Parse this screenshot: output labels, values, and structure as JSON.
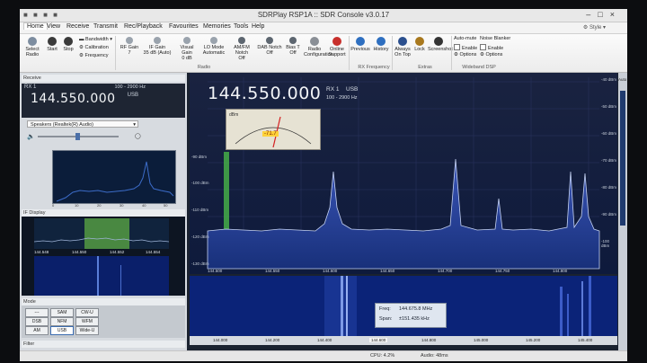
{
  "window": {
    "title": "SDRPlay RSP1A :: SDR Console v3.0.17"
  },
  "menu": [
    "Home",
    "View",
    "Receive",
    "Transmit",
    "Rec/Playback",
    "Favourites",
    "Memories",
    "Tools",
    "Help"
  ],
  "style_label": "Style",
  "ribbon": {
    "select_radio": "Select Radio",
    "start": "Start",
    "stop": "Stop",
    "bandwidth": "Bandwidth",
    "calibration": "Calibration",
    "frequency": "Frequency",
    "rf_gain_label": "RF Gain",
    "rf_gain_value": "7",
    "if_gain_label": "IF Gain",
    "if_gain_value": "35 dB (Auto)",
    "visual_gain_label": "Visual Gain",
    "visual_gain_value": "0 dB",
    "lo_mode_label": "LO Mode",
    "lo_mode_value": "Automatic",
    "am_fm_notch_label": "AM/FM Notch",
    "am_fm_notch_value": "Off",
    "dab_notch_label": "DAB Notch",
    "dab_notch_value": "Off",
    "bias_t_label": "Bias T",
    "bias_t_value": "Off",
    "radio_configuration": "Radio Configuration",
    "online_support": "Online Support",
    "previous": "Previous",
    "history": "History",
    "always_on_top": "Always On Top",
    "lock": "Lock",
    "screenshot": "Screenshot",
    "auto_mute": "Auto-mute",
    "noise_blanker": "Noise Blanker",
    "enable_1": "Enable",
    "enable_2": "Enable",
    "options_1": "Options",
    "options_2": "Options",
    "group_radio": "Radio",
    "group_rx_frequency": "RX Frequency",
    "group_extras": "Extras",
    "group_wideband_dsp": "Wideband DSP"
  },
  "left": {
    "receive_title": "Receive",
    "rx_label": "RX 1",
    "bandwidth": "100 - 2900 Hz",
    "frequency": "144.550.000",
    "mode": "USB",
    "audio_device": "Speakers (Realtek(R) Audio)",
    "if_display_title": "IF Display",
    "if_freqs": [
      "144.548",
      "144.550",
      "144.552",
      "144.554"
    ],
    "mode_title": "Mode",
    "modes": [
      "SAM",
      "CW-U",
      "NFM",
      "WFM",
      "USB",
      "Wide-U",
      "DSB",
      "AM",
      "---"
    ],
    "filter_title": "Filter",
    "mini_scale": [
      "0",
      "10",
      "20",
      "30",
      "40",
      "50"
    ]
  },
  "spectrum": {
    "frequency": "144.550.000",
    "rx_label": "RX 1",
    "mode": "USB",
    "bandwidth": "100 - 2900 Hz",
    "meter_reading": "-71.7",
    "meter_unit": "dBm",
    "dbm_labels": [
      "-40 dBm",
      "-45 dBm",
      "-50 dBm",
      "-55 dBm",
      "-60 dBm",
      "-65 dBm",
      "-70 dBm",
      "-75 dBm",
      "-80 dBm",
      "-85 dBm",
      "-90 dBm",
      "-95 dBm",
      "-100 dBm",
      "-105 dBm",
      "-110 dBm",
      "-115 dBm",
      "-120 dBm",
      "-125 dBm",
      "-130 dBm",
      "-135 dBm"
    ],
    "freq_labels": [
      "144.500",
      "144.550",
      "144.600",
      "144.650",
      "144.700",
      "144.750",
      "144.800"
    ],
    "auto_label": "Auto"
  },
  "waterfall": {
    "tooltip_freq_key": "Freq:",
    "tooltip_freq_value": "144.675.8 MHz",
    "tooltip_span_key": "Span:",
    "tooltip_span_value": "±151.435 kHz",
    "axis_labels": [
      "144.000",
      "144.200",
      "144.400",
      "144.600",
      "144.800",
      "145.000",
      "145.200",
      "145.400"
    ]
  },
  "status": {
    "cpu": "CPU: 4.2%",
    "audio": "Audio: 48ms"
  }
}
